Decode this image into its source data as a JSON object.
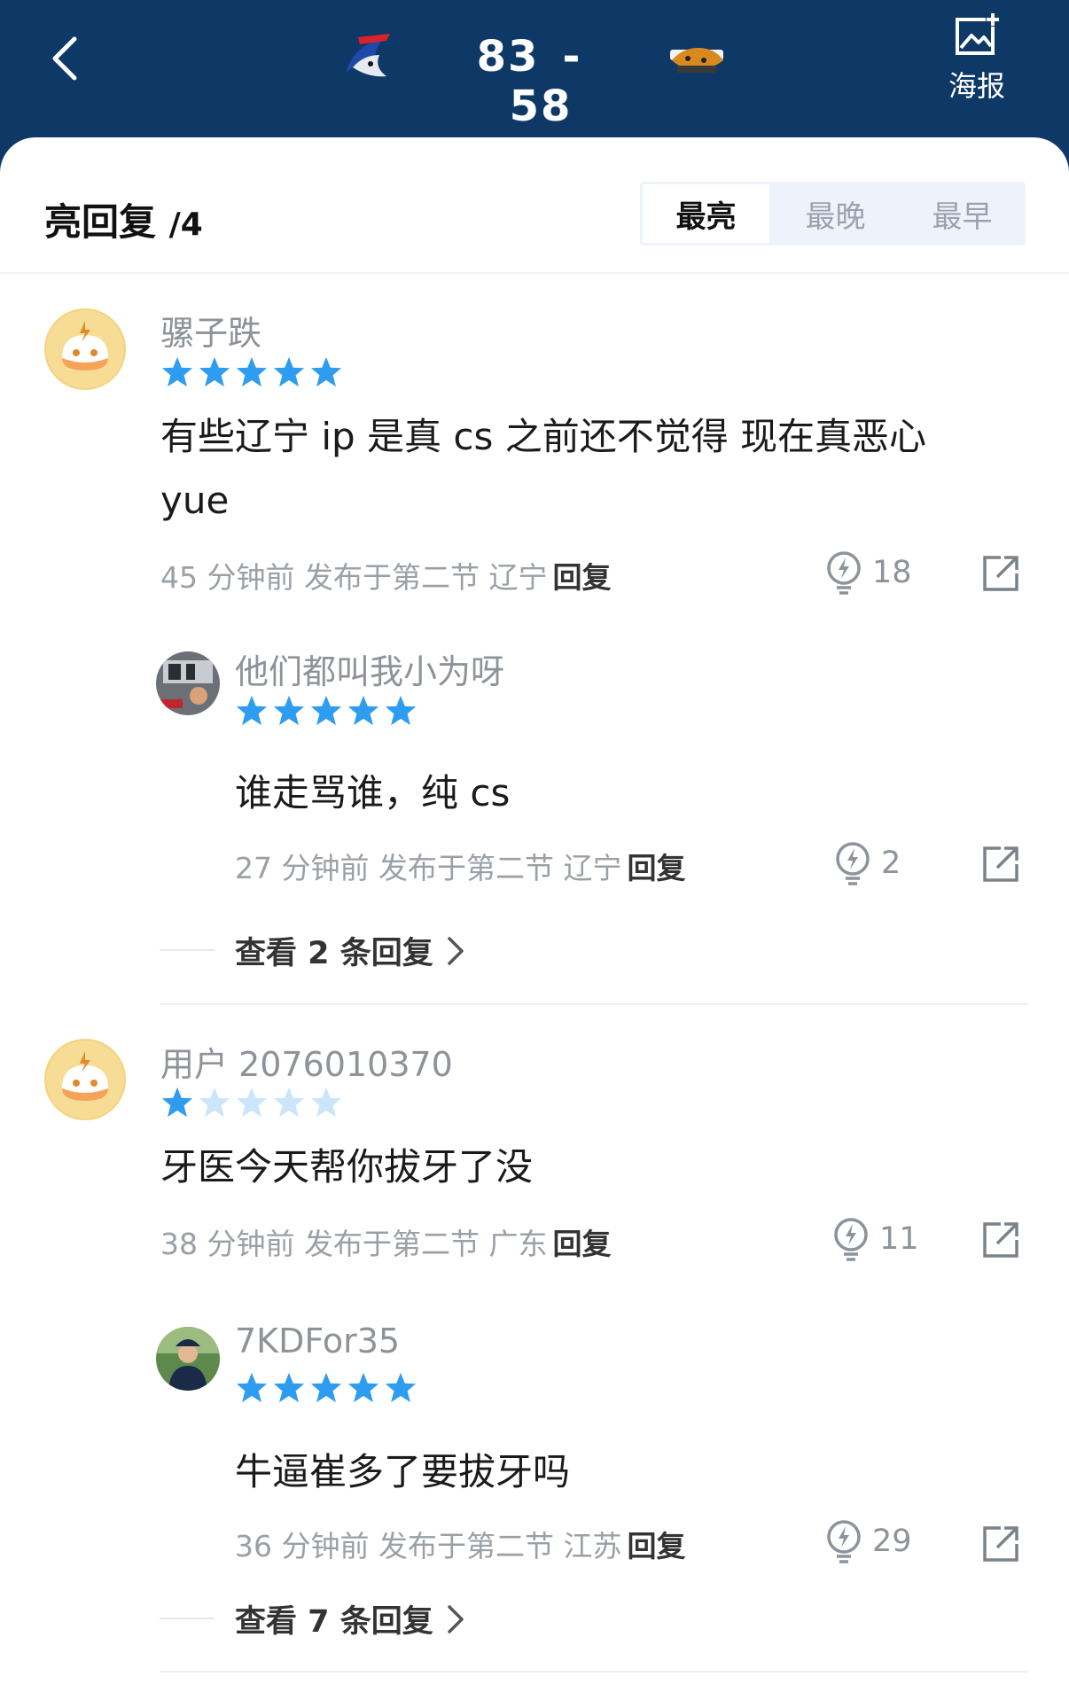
{
  "header": {
    "back_icon": "chevron-left-icon",
    "home_team_logo": "sharks-logo",
    "away_team_logo": "leopards-logo",
    "home_score": "83",
    "separator": "-",
    "away_score": "58",
    "poster_label": "海报",
    "poster_icon": "image-edit-icon"
  },
  "section": {
    "title": "亮回复",
    "count": "/4"
  },
  "sort_tabs": [
    "最亮",
    "最晚",
    "最早"
  ],
  "comments": [
    {
      "username": "骡子跌",
      "rating": 5,
      "content_line1": "有些辽宁 ip 是真 cs 之前还不觉得 现在真恶心",
      "content_line2": "yue",
      "meta": "45 分钟前 发布于第二节 辽宁",
      "reply_label": "回复",
      "likes": "18",
      "reply": {
        "username": "他们都叫我小为呀",
        "rating": 5,
        "content": "谁走骂谁，纯 cs",
        "meta": "27 分钟前 发布于第二节 辽宁",
        "reply_label": "回复",
        "likes": "2"
      },
      "more_replies": "查看 2 条回复"
    },
    {
      "username": "用户 2076010370",
      "rating": 1,
      "content_line1": "牙医今天帮你拔牙了没",
      "meta": "38 分钟前 发布于第二节 广东",
      "reply_label": "回复",
      "likes": "11",
      "reply": {
        "username": "7KDFor35",
        "rating": 5,
        "content": "牛逼崔多了要拔牙吗",
        "meta": "36 分钟前 发布于第二节 江苏",
        "reply_label": "回复",
        "likes": "29"
      },
      "more_replies": "查看 7 条回复"
    }
  ],
  "colors": {
    "header_bg": "#0e3866",
    "star_filled": "#2e9cf0",
    "star_empty": "#cbe6fb",
    "avatar_default": "#f3d37d"
  }
}
